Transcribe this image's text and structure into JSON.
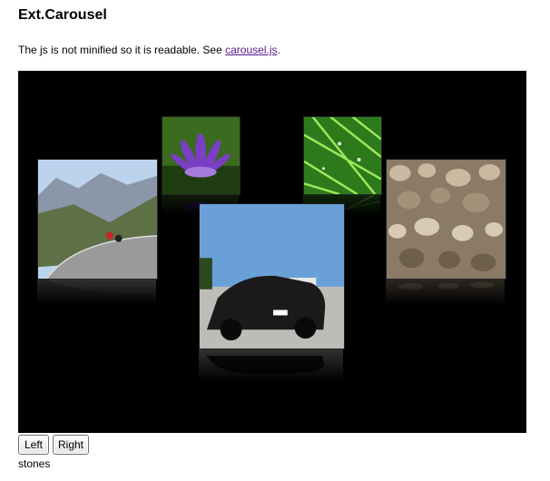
{
  "page": {
    "title": "Ext.Carousel",
    "description_prefix": "The js is not minified so it is readable. See ",
    "link_text": "carousel.js",
    "description_suffix": "."
  },
  "carousel": {
    "images": [
      "cyclists",
      "lotus",
      "grass",
      "stones",
      "car"
    ],
    "current_caption": "stones"
  },
  "controls": {
    "left_label": "Left",
    "right_label": "Right"
  }
}
